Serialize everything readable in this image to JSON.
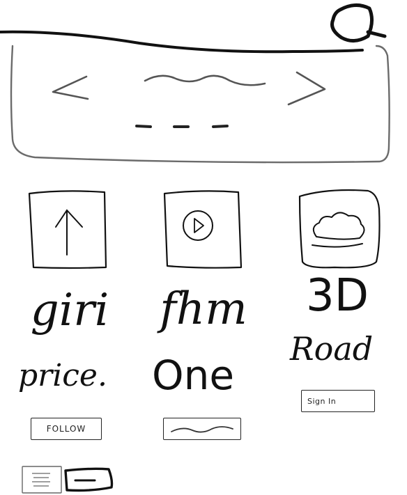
{
  "carousel": {
    "prev_icon": "chevron-left-icon",
    "next_icon": "chevron-right-icon",
    "title_squiggle_icon": "squiggle-icon",
    "pagination_icon": "dots-icon"
  },
  "header": {
    "search_icon": "search-icon"
  },
  "tiles": [
    {
      "icon": "upload-arrow-icon",
      "caption": "giri"
    },
    {
      "icon": "play-icon",
      "caption": "fhm"
    },
    {
      "icon": "cloud-icon",
      "caption": "3D"
    }
  ],
  "cards": [
    {
      "title": "price.",
      "button_label": "FOLLOW"
    },
    {
      "title": "One",
      "button_label": ""
    },
    {
      "title": "Road",
      "button_label": "Sign In"
    }
  ],
  "bottom_toggle": {
    "left_icon": "text-lines-icon",
    "right_icon": "minus-icon"
  },
  "colors": {
    "ink": "#111111",
    "panel_border": "#6b6b6b"
  }
}
